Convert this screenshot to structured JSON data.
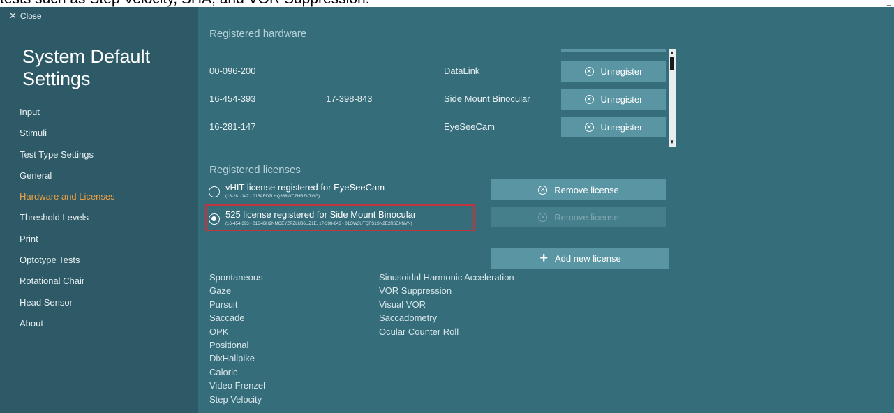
{
  "caption": {
    "text": "tests such as Step Velocity, SHA, and VOR Suppression."
  },
  "close": {
    "label": "Close"
  },
  "sidebar": {
    "title": "System Default Settings",
    "items": [
      {
        "label": "Input",
        "active": false
      },
      {
        "label": "Stimuli",
        "active": false
      },
      {
        "label": "Test Type Settings",
        "active": false
      },
      {
        "label": "General",
        "active": false
      },
      {
        "label": "Hardware and Licenses",
        "active": true
      },
      {
        "label": "Threshold Levels",
        "active": false
      },
      {
        "label": "Print",
        "active": false
      },
      {
        "label": "Optotype Tests",
        "active": false
      },
      {
        "label": "Rotational Chair",
        "active": false
      },
      {
        "label": "Head Sensor",
        "active": false
      },
      {
        "label": "About",
        "active": false
      }
    ]
  },
  "hardware": {
    "title": "Registered hardware",
    "rows": [
      {
        "serial1": "00-096-200",
        "serial2": "",
        "device": "DataLink",
        "button": "Unregister"
      },
      {
        "serial1": "16-454-393",
        "serial2": "17-398-843",
        "device": "Side Mount Binocular",
        "button": "Unregister"
      },
      {
        "serial1": "16-281-147",
        "serial2": "",
        "device": "EyeSeeCam",
        "button": "Unregister"
      }
    ]
  },
  "licenses": {
    "title": "Registered licenses",
    "items": [
      {
        "name": "vHIT license registered for EyeSeeCam",
        "detail": "(16-281-147 - 015AED7LHQ338WCZHRZVTGG)",
        "checked": false,
        "remove_label": "Remove license",
        "remove_enabled": true
      },
      {
        "name": "525 license registered for Side Mount Binocular",
        "detail": "(16-454-393 - 01D4BH2NMCEYZPZLU36UZ1E, 17-398-843 - 01QW3UTQFS1SN2E2R6EXNVN)",
        "checked": true,
        "remove_label": "Remove license",
        "remove_enabled": false
      }
    ],
    "add_label": "Add new license"
  },
  "tests": {
    "column1": [
      "Spontaneous",
      "Gaze",
      "Pursuit",
      "Saccade",
      "OPK",
      "Positional",
      "DixHallpike",
      "Caloric",
      "Video Frenzel",
      "Step Velocity"
    ],
    "column2": [
      "Sinusoidal Harmonic Acceleration",
      "VOR Suppression",
      "Visual VOR",
      "Saccadometry",
      "Ocular Counter Roll"
    ]
  },
  "colors": {
    "sidebar_bg": "#2e5a67",
    "main_bg": "#356d7b",
    "button_bg": "#5a95a3",
    "active_nav": "#f0a040",
    "highlight": "#c0363e"
  },
  "icons": {
    "close": "close-icon",
    "unregister": "circle-x-icon",
    "remove": "circle-x-icon",
    "add": "plus-icon"
  }
}
